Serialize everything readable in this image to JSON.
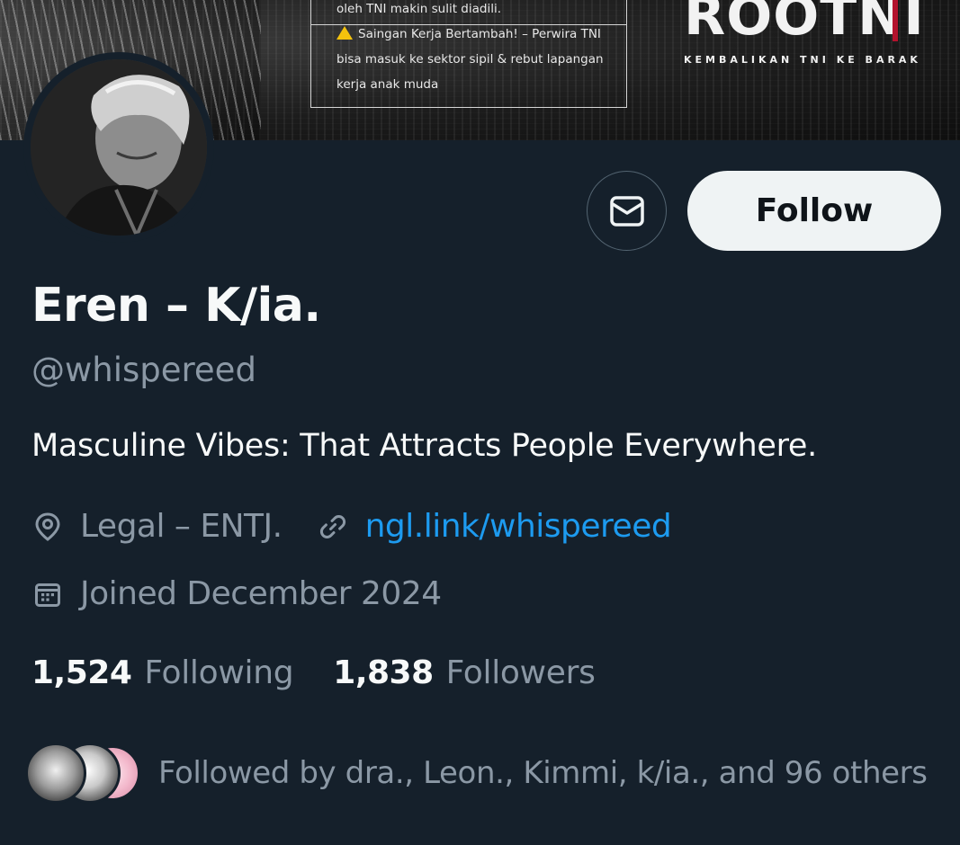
{
  "banner": {
    "notice_lines": [
      "oleh TNI makin sulit diadili.",
      "Saingan Kerja Bertambah! – Perwira TNI",
      "bisa masuk ke sektor sipil & rebut lapangan",
      "kerja anak muda"
    ],
    "brand": "ROOTNI",
    "tagline": "KEMBALIKAN TNI KE BARAK"
  },
  "actions": {
    "message_icon": "envelope-icon",
    "follow_label": "Follow"
  },
  "profile": {
    "display_name": "Eren – K/ia.",
    "handle": "@whispereed",
    "bio": "Masculine Vibes: That Attracts People Everywhere.",
    "location": "Legal – ENTJ.",
    "location_icon": "location-pin-icon",
    "link_icon": "link-icon",
    "link": "ngl.link/whispereed",
    "joined_icon": "calendar-icon",
    "joined": "Joined December 2024"
  },
  "stats": {
    "following_count": "1,524",
    "following_label": "Following",
    "followers_count": "1,838",
    "followers_label": "Followers"
  },
  "followed_by": {
    "text": "Followed by dra., Leon., Kimmi, k/ia., and 96 others"
  },
  "colors": {
    "background": "#15202b",
    "primary_text": "#f7f9f9",
    "secondary_text": "#8b98a5",
    "link": "#1d9bf0",
    "follow_button_bg": "#eff3f4",
    "banner_accent": "#b3122d"
  }
}
